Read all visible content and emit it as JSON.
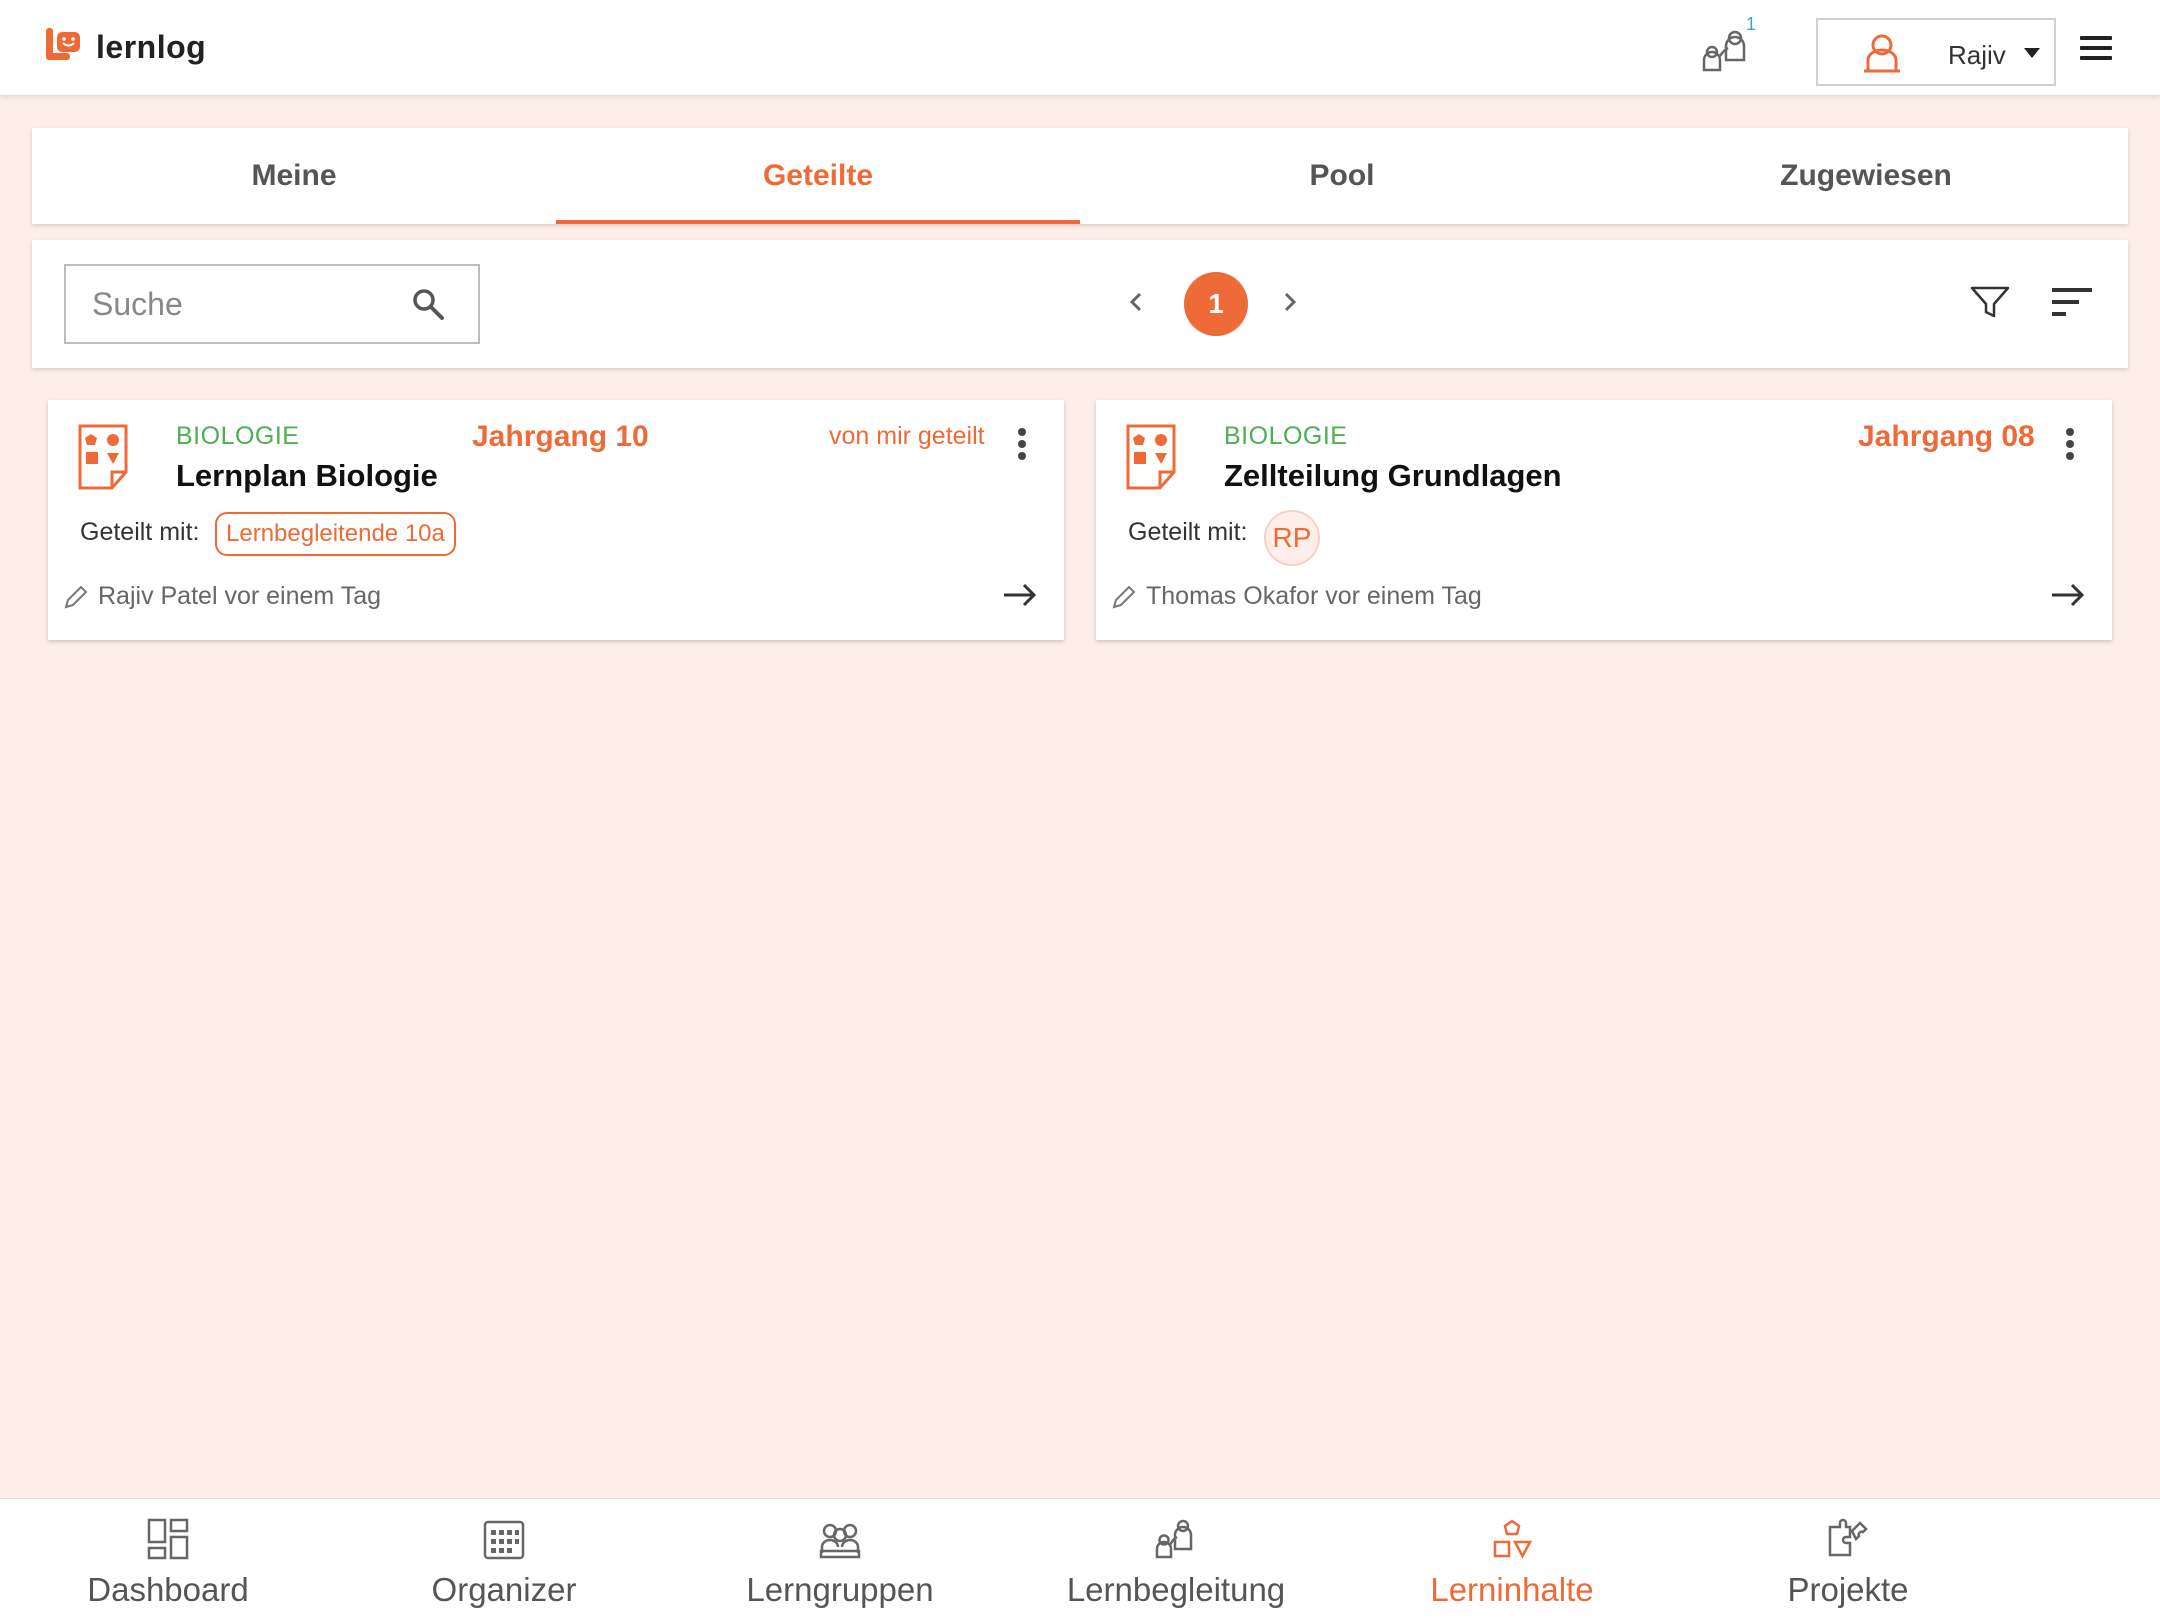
{
  "app": {
    "name": "lernlog"
  },
  "header": {
    "notification_count": "1",
    "user_name": "Rajiv"
  },
  "tabs": [
    {
      "label": "Meine"
    },
    {
      "label": "Geteilte",
      "active": true
    },
    {
      "label": "Pool"
    },
    {
      "label": "Zugewiesen"
    }
  ],
  "toolbar": {
    "search_placeholder": "Suche",
    "current_page": "1"
  },
  "cards": [
    {
      "subject": "BIOLOGIE",
      "title": "Lernplan Biologie",
      "grade": "Jahrgang 10",
      "status": "von mir geteilt",
      "shared_label": "Geteilt mit:",
      "shared_with": "Lernbegleitende 10a",
      "author": "Rajiv Patel vor einem Tag"
    },
    {
      "subject": "BIOLOGIE",
      "title": "Zellteilung Grundlagen",
      "grade": "Jahrgang 08",
      "status": "",
      "shared_label": "Geteilt mit:",
      "shared_with": "RP",
      "author": "Thomas Okafor vor einem Tag"
    }
  ],
  "bottom_nav": [
    {
      "label": "Dashboard",
      "icon": "dashboard-icon"
    },
    {
      "label": "Organizer",
      "icon": "calendar-icon"
    },
    {
      "label": "Lerngruppen",
      "icon": "groups-icon"
    },
    {
      "label": "Lernbegleitung",
      "icon": "mentoring-icon"
    },
    {
      "label": "Lerninhalte",
      "icon": "shapes-icon",
      "active": true
    },
    {
      "label": "Projekte",
      "icon": "puzzle-icon"
    }
  ],
  "colors": {
    "accent": "#ee6a36",
    "subject": "#4caf50",
    "background": "#fdeeea"
  }
}
